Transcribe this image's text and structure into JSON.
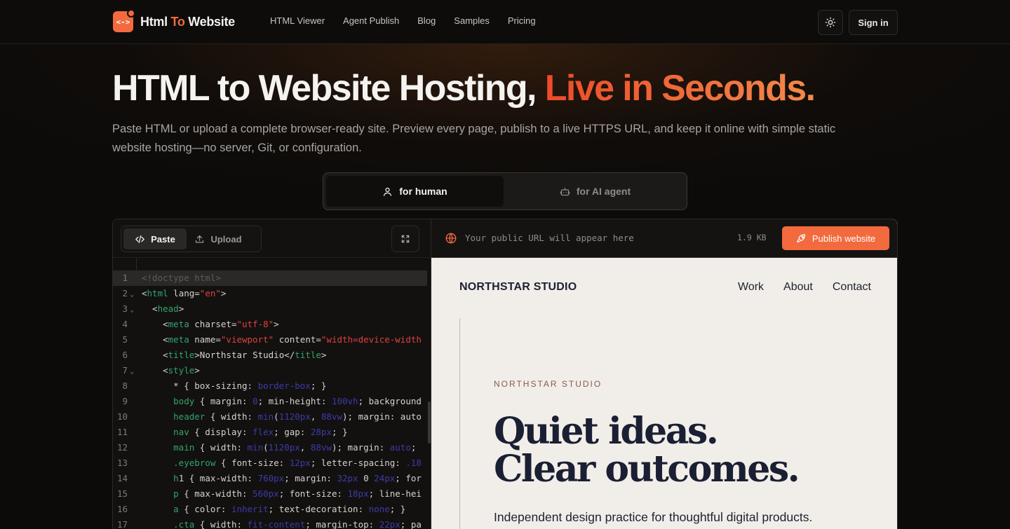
{
  "brand": {
    "part1": "Html ",
    "part2": "To",
    "part3": " Website",
    "mark": "<->"
  },
  "nav": {
    "links": [
      "HTML Viewer",
      "Agent Publish",
      "Blog",
      "Samples",
      "Pricing"
    ],
    "signin": "Sign in"
  },
  "hero": {
    "title_main": "HTML to Website Hosting, ",
    "title_highlight": "Live in Seconds.",
    "subtitle": "Paste HTML or upload a complete browser-ready site. Preview every page, publish to a live HTTPS URL, and keep it online with simple static website hosting—no server, Git, or configuration."
  },
  "modes": {
    "human": "for human",
    "agent": "for AI agent",
    "active": "human"
  },
  "editor": {
    "paste": "Paste",
    "upload": "Upload",
    "active_tab": "Paste",
    "lines": [
      "<!doctype html>",
      "<html lang=\"en\">",
      "  <head>",
      "    <meta charset=\"utf-8\">",
      "    <meta name=\"viewport\" content=\"width=device-width",
      "    <title>Northstar Studio</title>",
      "    <style>",
      "      * { box-sizing: border-box; }",
      "      body { margin: 0; min-height: 100vh; background",
      "      header { width: min(1120px, 88vw); margin: auto",
      "      nav { display: flex; gap: 28px; }",
      "      main { width: min(1120px, 88vw); margin: auto;",
      "      .eyebrow { font-size: 12px; letter-spacing: .18",
      "      h1 { max-width: 760px; margin: 32px 0 24px; for",
      "      p { max-width: 560px; font-size: 18px; line-hei",
      "      a { color: inherit; text-decoration: none; }",
      "      .cta { width: fit-content; margin-top: 22px; pa"
    ]
  },
  "preview": {
    "url_placeholder": "Your public URL will appear here",
    "size": "1.9 KB",
    "publish": "Publish website",
    "site": {
      "brand": "NORTHSTAR STUDIO",
      "nav": [
        "Work",
        "About",
        "Contact"
      ],
      "eyebrow": "NORTHSTAR STUDIO",
      "headline_1": "Quiet ideas.",
      "headline_2": "Clear outcomes.",
      "tagline": "Independent design practice for thoughtful digital products."
    }
  },
  "colors": {
    "accent": "#f26a3d",
    "background": "#0c0b0a",
    "preview_bg": "#f1eee9"
  }
}
